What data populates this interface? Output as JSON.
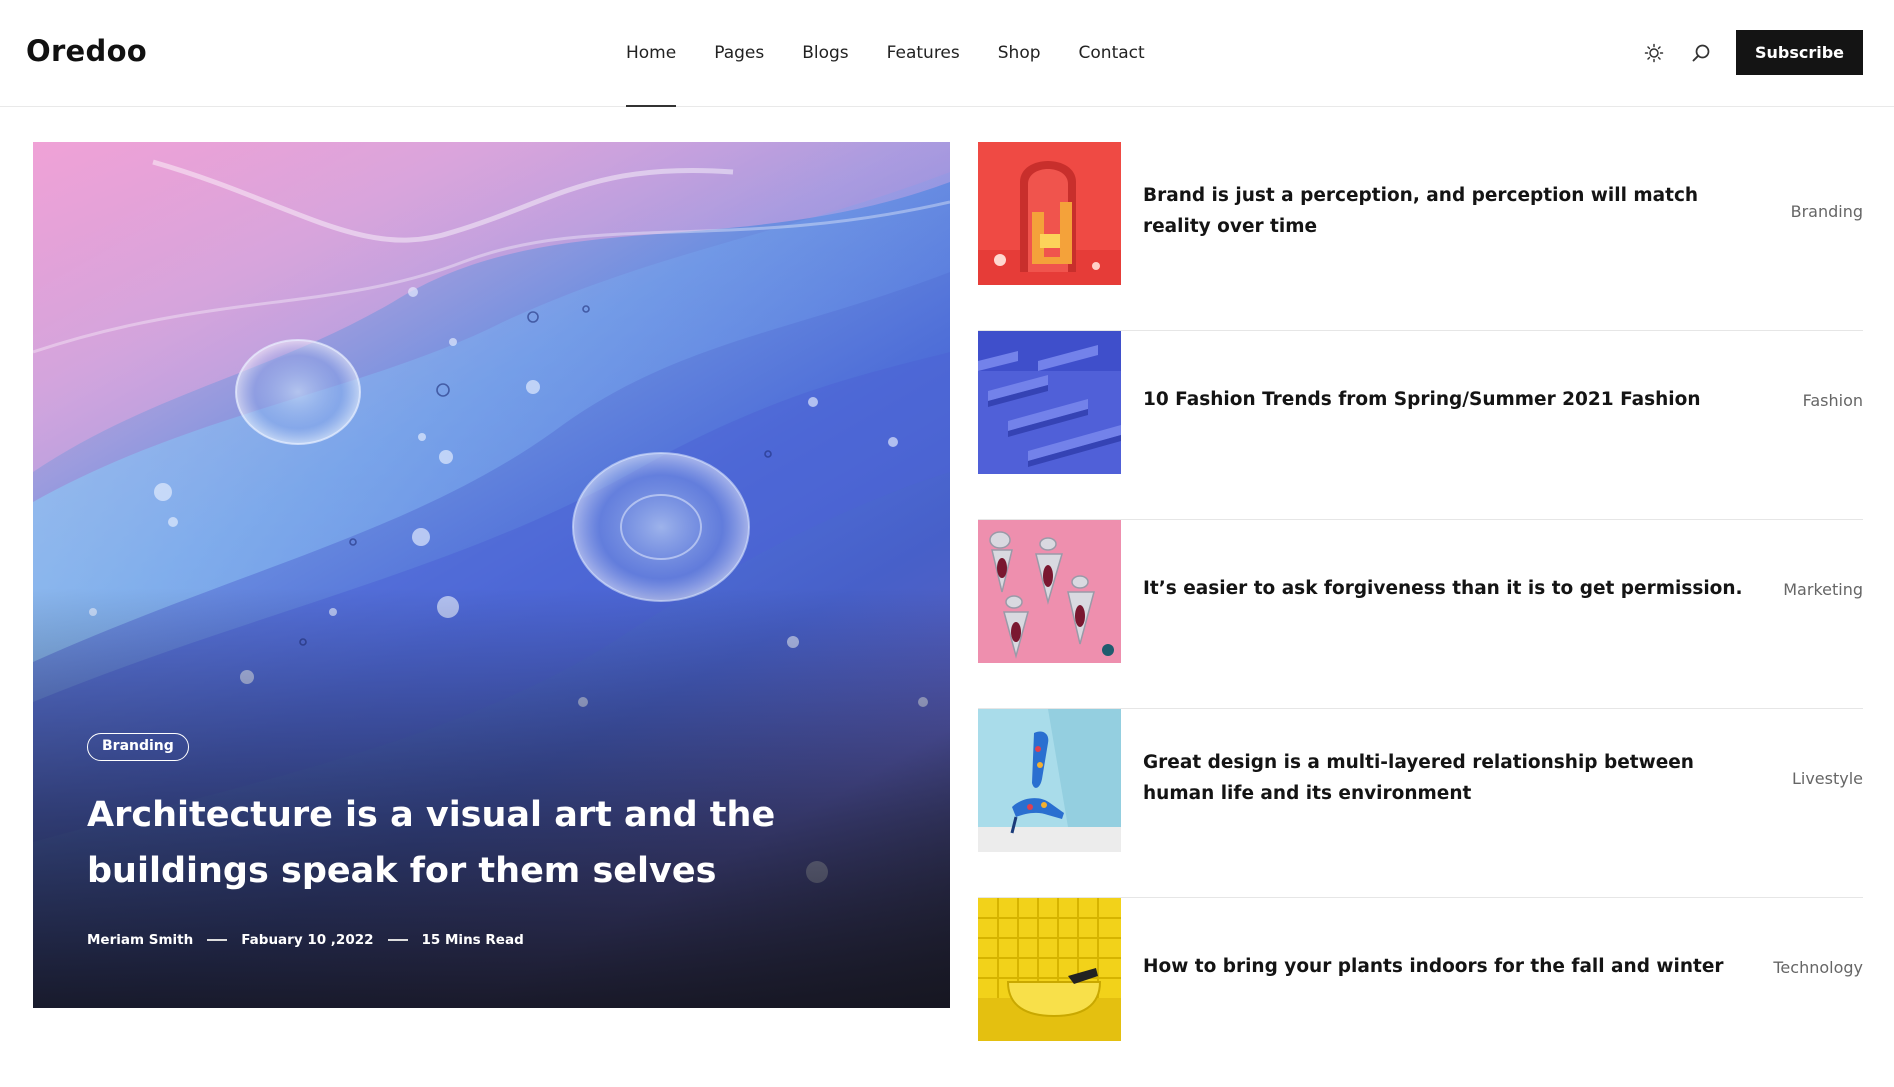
{
  "site": {
    "logo": "Oredoo"
  },
  "nav": {
    "items": [
      {
        "label": "Home",
        "active": true
      },
      {
        "label": "Pages"
      },
      {
        "label": "Blogs"
      },
      {
        "label": "Features"
      },
      {
        "label": "Shop"
      },
      {
        "label": "Contact"
      }
    ]
  },
  "header_tools": {
    "theme_icon": "sun-icon",
    "search_icon": "search-icon",
    "subscribe_label": "Subscribe"
  },
  "hero": {
    "category": "Branding",
    "title": "Architecture is a visual art and the buildings speak for them selves",
    "author": "Meriam Smith",
    "date": "Fabuary 10 ,2022",
    "read_time": "15 Mins Read"
  },
  "posts": [
    {
      "title": "Brand is just a perception, and perception will match reality over time",
      "category": "Branding",
      "thumb": "red-arch-letter"
    },
    {
      "title": "10 Fashion Trends from Spring/Summer 2021 Fashion",
      "category": "Fashion",
      "thumb": "blue-steps"
    },
    {
      "title": "It’s easier to ask forgiveness than it is to get permission.",
      "category": "Marketing",
      "thumb": "pink-earrings"
    },
    {
      "title": "Great design is a multi-layered relationship between human life and its environment",
      "category": "Livestyle",
      "thumb": "heels-on-blue"
    },
    {
      "title": "How to bring your plants indoors for the fall and winter",
      "category": "Technology",
      "thumb": "yellow-bathtub"
    }
  ]
}
